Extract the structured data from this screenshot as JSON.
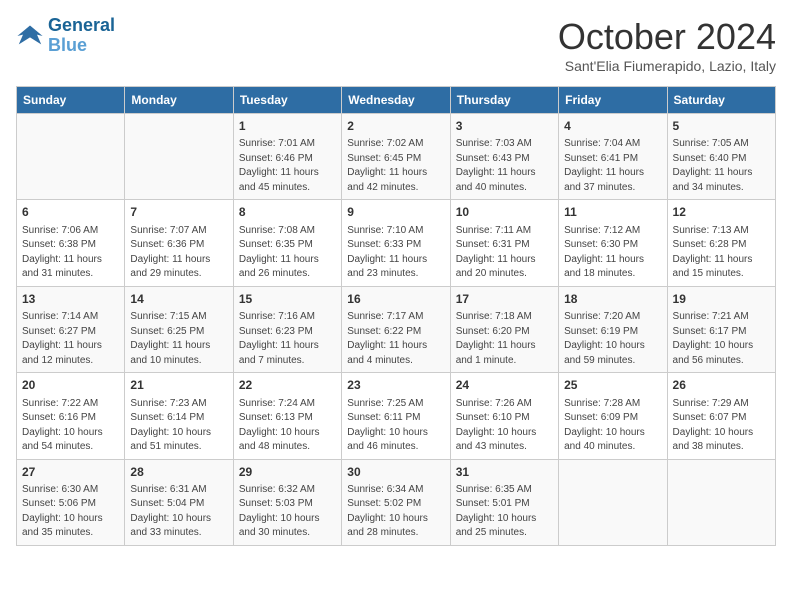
{
  "header": {
    "logo_line1": "General",
    "logo_line2": "Blue",
    "month": "October 2024",
    "location": "Sant'Elia Fiumerapido, Lazio, Italy"
  },
  "weekdays": [
    "Sunday",
    "Monday",
    "Tuesday",
    "Wednesday",
    "Thursday",
    "Friday",
    "Saturday"
  ],
  "weeks": [
    [
      {
        "day": "",
        "info": ""
      },
      {
        "day": "",
        "info": ""
      },
      {
        "day": "1",
        "info": "Sunrise: 7:01 AM\nSunset: 6:46 PM\nDaylight: 11 hours and 45 minutes."
      },
      {
        "day": "2",
        "info": "Sunrise: 7:02 AM\nSunset: 6:45 PM\nDaylight: 11 hours and 42 minutes."
      },
      {
        "day": "3",
        "info": "Sunrise: 7:03 AM\nSunset: 6:43 PM\nDaylight: 11 hours and 40 minutes."
      },
      {
        "day": "4",
        "info": "Sunrise: 7:04 AM\nSunset: 6:41 PM\nDaylight: 11 hours and 37 minutes."
      },
      {
        "day": "5",
        "info": "Sunrise: 7:05 AM\nSunset: 6:40 PM\nDaylight: 11 hours and 34 minutes."
      }
    ],
    [
      {
        "day": "6",
        "info": "Sunrise: 7:06 AM\nSunset: 6:38 PM\nDaylight: 11 hours and 31 minutes."
      },
      {
        "day": "7",
        "info": "Sunrise: 7:07 AM\nSunset: 6:36 PM\nDaylight: 11 hours and 29 minutes."
      },
      {
        "day": "8",
        "info": "Sunrise: 7:08 AM\nSunset: 6:35 PM\nDaylight: 11 hours and 26 minutes."
      },
      {
        "day": "9",
        "info": "Sunrise: 7:10 AM\nSunset: 6:33 PM\nDaylight: 11 hours and 23 minutes."
      },
      {
        "day": "10",
        "info": "Sunrise: 7:11 AM\nSunset: 6:31 PM\nDaylight: 11 hours and 20 minutes."
      },
      {
        "day": "11",
        "info": "Sunrise: 7:12 AM\nSunset: 6:30 PM\nDaylight: 11 hours and 18 minutes."
      },
      {
        "day": "12",
        "info": "Sunrise: 7:13 AM\nSunset: 6:28 PM\nDaylight: 11 hours and 15 minutes."
      }
    ],
    [
      {
        "day": "13",
        "info": "Sunrise: 7:14 AM\nSunset: 6:27 PM\nDaylight: 11 hours and 12 minutes."
      },
      {
        "day": "14",
        "info": "Sunrise: 7:15 AM\nSunset: 6:25 PM\nDaylight: 11 hours and 10 minutes."
      },
      {
        "day": "15",
        "info": "Sunrise: 7:16 AM\nSunset: 6:23 PM\nDaylight: 11 hours and 7 minutes."
      },
      {
        "day": "16",
        "info": "Sunrise: 7:17 AM\nSunset: 6:22 PM\nDaylight: 11 hours and 4 minutes."
      },
      {
        "day": "17",
        "info": "Sunrise: 7:18 AM\nSunset: 6:20 PM\nDaylight: 11 hours and 1 minute."
      },
      {
        "day": "18",
        "info": "Sunrise: 7:20 AM\nSunset: 6:19 PM\nDaylight: 10 hours and 59 minutes."
      },
      {
        "day": "19",
        "info": "Sunrise: 7:21 AM\nSunset: 6:17 PM\nDaylight: 10 hours and 56 minutes."
      }
    ],
    [
      {
        "day": "20",
        "info": "Sunrise: 7:22 AM\nSunset: 6:16 PM\nDaylight: 10 hours and 54 minutes."
      },
      {
        "day": "21",
        "info": "Sunrise: 7:23 AM\nSunset: 6:14 PM\nDaylight: 10 hours and 51 minutes."
      },
      {
        "day": "22",
        "info": "Sunrise: 7:24 AM\nSunset: 6:13 PM\nDaylight: 10 hours and 48 minutes."
      },
      {
        "day": "23",
        "info": "Sunrise: 7:25 AM\nSunset: 6:11 PM\nDaylight: 10 hours and 46 minutes."
      },
      {
        "day": "24",
        "info": "Sunrise: 7:26 AM\nSunset: 6:10 PM\nDaylight: 10 hours and 43 minutes."
      },
      {
        "day": "25",
        "info": "Sunrise: 7:28 AM\nSunset: 6:09 PM\nDaylight: 10 hours and 40 minutes."
      },
      {
        "day": "26",
        "info": "Sunrise: 7:29 AM\nSunset: 6:07 PM\nDaylight: 10 hours and 38 minutes."
      }
    ],
    [
      {
        "day": "27",
        "info": "Sunrise: 6:30 AM\nSunset: 5:06 PM\nDaylight: 10 hours and 35 minutes."
      },
      {
        "day": "28",
        "info": "Sunrise: 6:31 AM\nSunset: 5:04 PM\nDaylight: 10 hours and 33 minutes."
      },
      {
        "day": "29",
        "info": "Sunrise: 6:32 AM\nSunset: 5:03 PM\nDaylight: 10 hours and 30 minutes."
      },
      {
        "day": "30",
        "info": "Sunrise: 6:34 AM\nSunset: 5:02 PM\nDaylight: 10 hours and 28 minutes."
      },
      {
        "day": "31",
        "info": "Sunrise: 6:35 AM\nSunset: 5:01 PM\nDaylight: 10 hours and 25 minutes."
      },
      {
        "day": "",
        "info": ""
      },
      {
        "day": "",
        "info": ""
      }
    ]
  ]
}
